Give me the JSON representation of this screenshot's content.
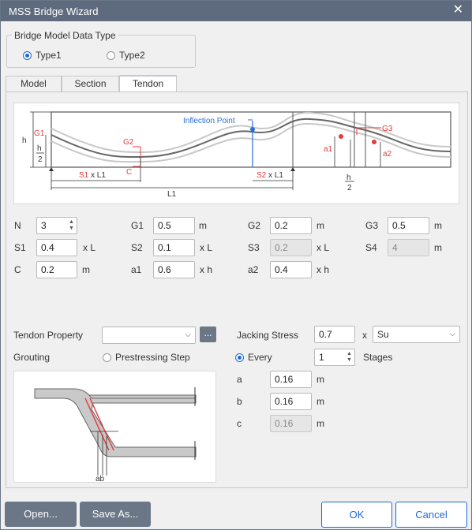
{
  "window": {
    "title": "MSS Bridge Wizard",
    "close_glyph": "✕"
  },
  "model_type": {
    "group_title": "Bridge Model Data Type",
    "options": [
      "Type1",
      "Type2"
    ],
    "selected": "Type1"
  },
  "tabs": [
    {
      "label": "Model"
    },
    {
      "label": "Section"
    },
    {
      "label": "Tendon"
    }
  ],
  "active_tab": "Tendon",
  "diagram": {
    "labels": {
      "h": "h",
      "G1": "G1",
      "h_over_2_num": "h",
      "h_over_2_den": "2",
      "G2": "G2",
      "C": "C",
      "S1": "S1",
      "xL1_a": "x L1",
      "S2": "S2",
      "xL1_b": "x L1",
      "L1": "L1",
      "inflection": "Inflection Point",
      "G3": "G3",
      "a1": "a1",
      "a2": "a2",
      "h2_num": "h",
      "h2_den": "2"
    },
    "colors": {
      "red": "#e23b3b",
      "blue": "#2a6fdb",
      "tendon": "#666666",
      "guide": "#c8c8c8"
    }
  },
  "params": {
    "N": {
      "label": "N",
      "value": "3"
    },
    "G1": {
      "label": "G1",
      "value": "0.5",
      "unit": "m"
    },
    "G2": {
      "label": "G2",
      "value": "0.2",
      "unit": "m"
    },
    "G3": {
      "label": "G3",
      "value": "0.5",
      "unit": "m"
    },
    "S1": {
      "label": "S1",
      "value": "0.4",
      "unit": "x L"
    },
    "S2": {
      "label": "S2",
      "value": "0.1",
      "unit": "x L"
    },
    "S3": {
      "label": "S3",
      "value": "0.2",
      "unit": "x L"
    },
    "S4": {
      "label": "S4",
      "value": "4",
      "unit": "m"
    },
    "C": {
      "label": "C",
      "value": "0.2",
      "unit": "m"
    },
    "a1": {
      "label": "a1",
      "value": "0.6",
      "unit": "x h"
    },
    "a2": {
      "label": "a2",
      "value": "0.4",
      "unit": "x h"
    }
  },
  "tendon_property": {
    "label": "Tendon Property",
    "value": "",
    "browse": "..."
  },
  "grouting": {
    "label": "Grouting",
    "option": "Prestressing Step"
  },
  "jacking": {
    "label": "Jacking Stress",
    "value": "0.7",
    "x": "x",
    "unit_value": "Su",
    "every_label": "Every",
    "every_value": "1",
    "stages_label": "Stages"
  },
  "section_params": {
    "a": {
      "label": "a",
      "value": "0.16",
      "unit": "m"
    },
    "b": {
      "label": "b",
      "value": "0.16",
      "unit": "m"
    },
    "c": {
      "label": "c",
      "value": "0.16",
      "unit": "m"
    }
  },
  "section_pic": {
    "ab_label": "ab"
  },
  "buttons": {
    "open": "Open...",
    "save_as": "Save As...",
    "ok": "OK",
    "cancel": "Cancel"
  }
}
